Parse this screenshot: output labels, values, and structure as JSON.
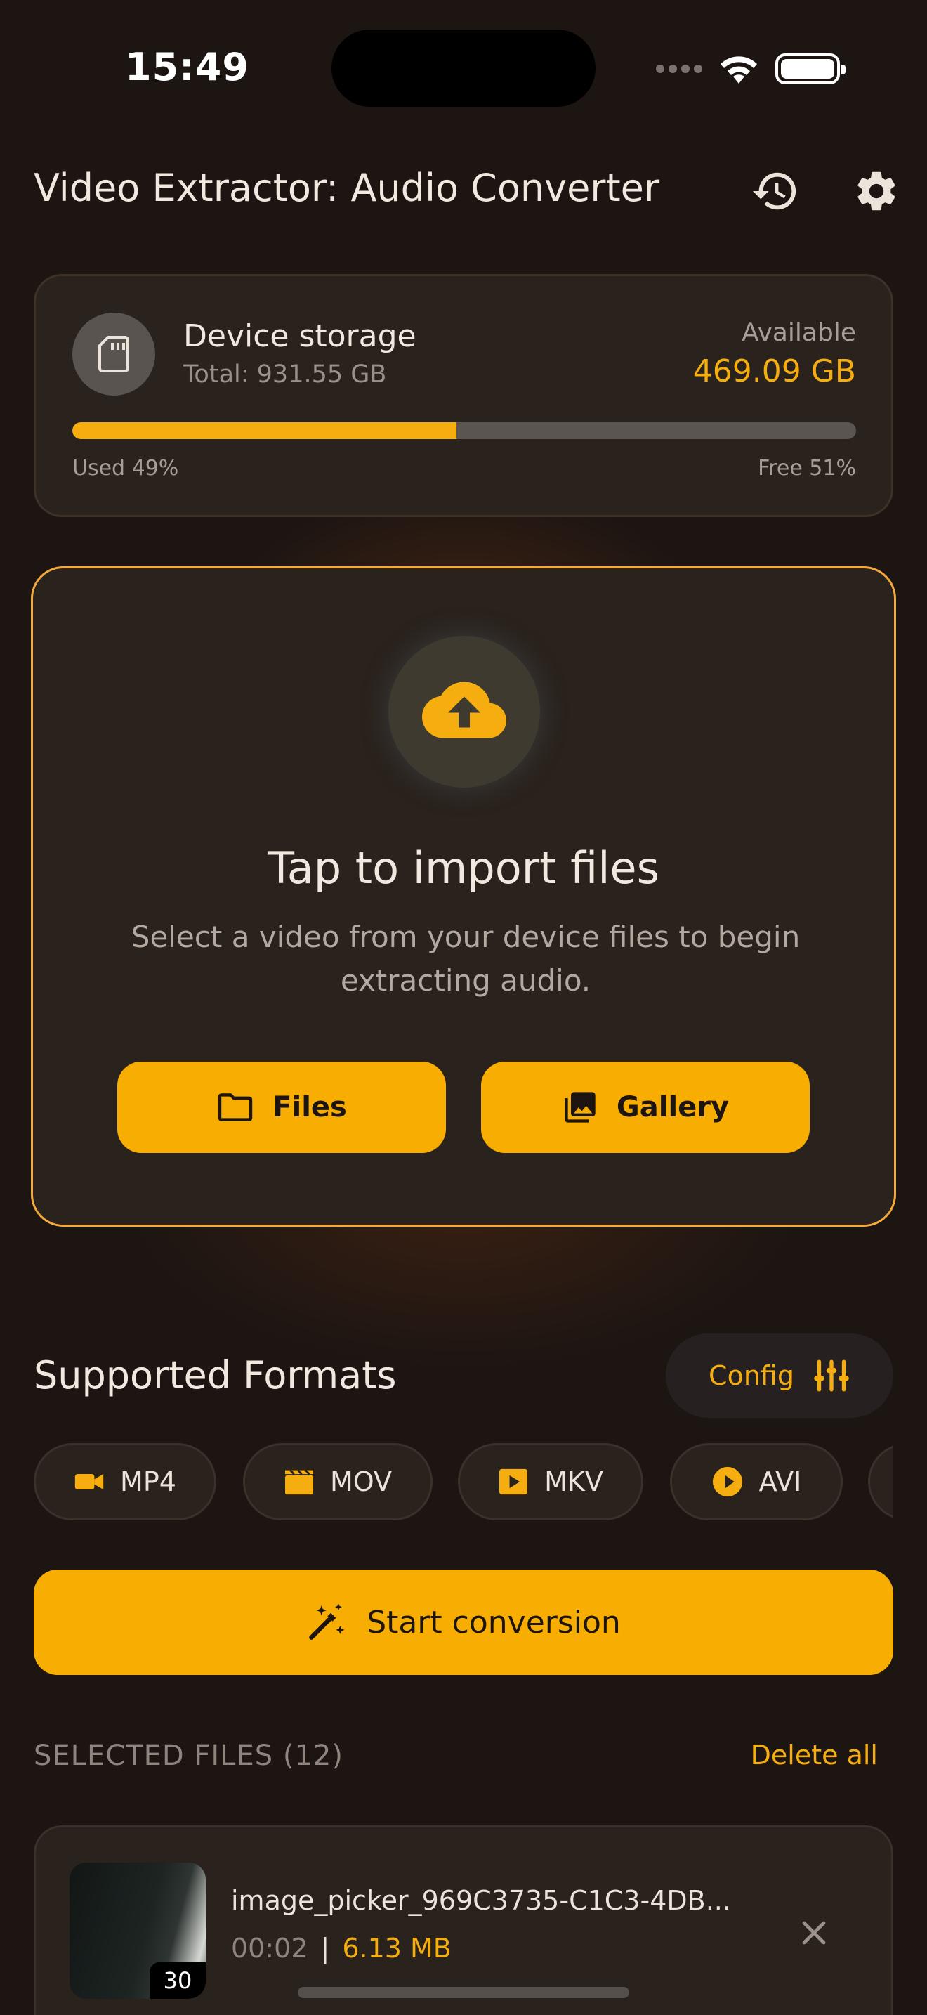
{
  "status": {
    "time": "15:49"
  },
  "header": {
    "title": "Video Extractor: Audio Converter",
    "history_icon": "history-icon",
    "settings_icon": "gear-icon"
  },
  "storage": {
    "title": "Device storage",
    "total": "Total: 931.55 GB",
    "available_label": "Available",
    "available_value": "469.09 GB",
    "used_fraction": 0.49,
    "used_label": "Used 49%",
    "free_label": "Free 51%"
  },
  "import": {
    "title": "Tap to import files",
    "subtitle": "Select a video from your device files to begin extracting audio.",
    "files_label": "Files",
    "gallery_label": "Gallery"
  },
  "formats": {
    "title": "Supported Formats",
    "config_label": "Config",
    "chips": [
      {
        "label": "MP4",
        "icon": "videocam-icon"
      },
      {
        "label": "MOV",
        "icon": "clapperboard-icon"
      },
      {
        "label": "MKV",
        "icon": "play-box-icon"
      },
      {
        "label": "AVI",
        "icon": "play-circle-icon"
      }
    ]
  },
  "start": {
    "label": "Start conversion"
  },
  "selected": {
    "title": "SELECTED FILES (12)",
    "delete_all": "Delete all",
    "files": [
      {
        "name": "image_picker_969C3735-C1C3-4DB...",
        "duration": "00:02",
        "separator": "|",
        "size": "6.13 MB",
        "thumb_badge": "30"
      }
    ]
  },
  "colors": {
    "accent": "#f8ad02",
    "background": "#1c1512",
    "card": "#2a221c",
    "import_border": "#f5a93a"
  }
}
